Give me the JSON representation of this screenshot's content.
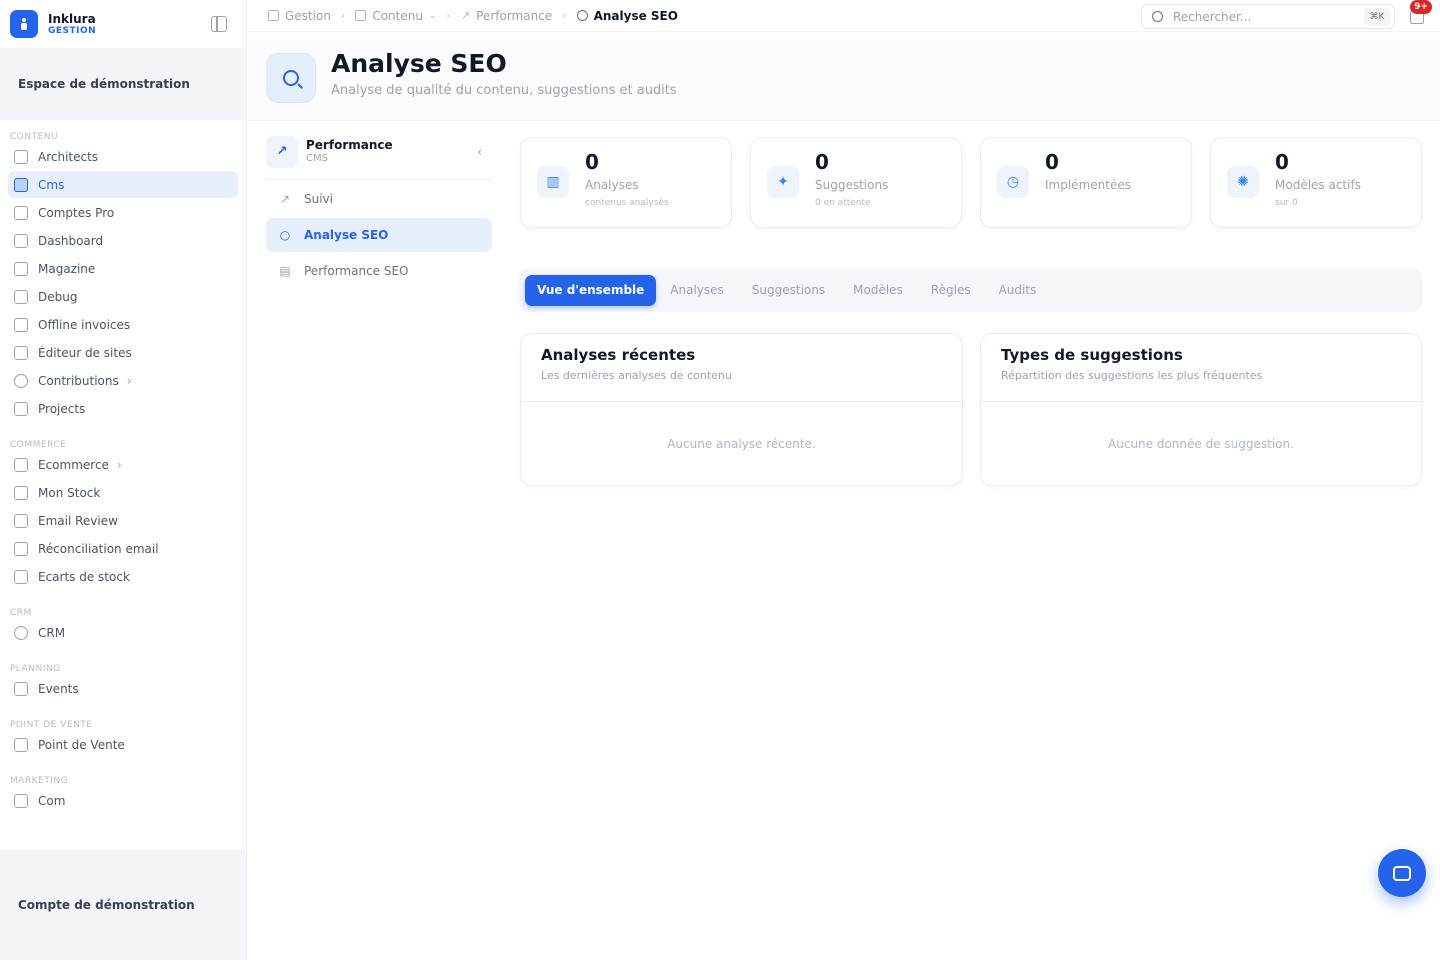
{
  "brand": {
    "name": "Inklura",
    "sub": "GESTION"
  },
  "sidebar": {
    "workspace": "Espace de démonstration",
    "account": "Compte de démonstration",
    "sections": [
      {
        "title": "CONTENU",
        "items": [
          {
            "label": "Architects",
            "icon": "building-icon",
            "active": false
          },
          {
            "label": "Cms",
            "icon": "document-icon",
            "active": true
          },
          {
            "label": "Comptes Pro",
            "icon": "document-icon",
            "active": false
          },
          {
            "label": "Dashboard",
            "icon": "grid-icon",
            "active": false
          },
          {
            "label": "Magazine",
            "icon": "newspaper-icon",
            "active": false
          },
          {
            "label": "Debug",
            "icon": "bug-icon",
            "active": false
          },
          {
            "label": "Offline invoices",
            "icon": "invoice-icon",
            "active": false
          },
          {
            "label": "Éditeur de sites",
            "icon": "terminal-icon",
            "active": false
          },
          {
            "label": "Contributions",
            "icon": "inbox-icon",
            "active": false,
            "chevron": true
          },
          {
            "label": "Projects",
            "icon": "folder-icon",
            "active": false
          }
        ]
      },
      {
        "title": "COMMERCE",
        "items": [
          {
            "label": "Ecommerce",
            "icon": "cart-icon",
            "active": false,
            "chevron": true
          },
          {
            "label": "Mon Stock",
            "icon": "cart-icon",
            "active": false
          },
          {
            "label": "Email Review",
            "icon": "cart-icon",
            "active": false
          },
          {
            "label": "Réconciliation email",
            "icon": "cart-icon",
            "active": false
          },
          {
            "label": "Ecarts de stock",
            "icon": "cart-icon",
            "active": false
          }
        ]
      },
      {
        "title": "CRM",
        "items": [
          {
            "label": "CRM",
            "icon": "users-icon",
            "active": false
          }
        ]
      },
      {
        "title": "PLANNING",
        "items": [
          {
            "label": "Events",
            "icon": "calendar-icon",
            "active": false
          }
        ]
      },
      {
        "title": "POINT DE VENTE",
        "items": [
          {
            "label": "Point de Vente",
            "icon": "store-icon",
            "active": false
          }
        ]
      },
      {
        "title": "MARKETING",
        "items": [
          {
            "label": "Com",
            "icon": "megaphone-icon",
            "active": false
          }
        ]
      }
    ]
  },
  "breadcrumb": [
    "Gestion",
    "Contenu",
    "Performance",
    "Analyse SEO"
  ],
  "search": {
    "placeholder": "Rechercher...",
    "shortcut": "⌘K"
  },
  "notifications": {
    "count": "9+"
  },
  "header": {
    "title": "Analyse SEO",
    "subtitle": "Analyse de qualité du contenu, suggestions et audits"
  },
  "subnav": {
    "title": "Performance",
    "subtitle": "CMS",
    "items": [
      {
        "label": "Suivi",
        "active": false
      },
      {
        "label": "Analyse SEO",
        "active": true
      },
      {
        "label": "Performance SEO",
        "active": false
      }
    ]
  },
  "stats": [
    {
      "value": "0",
      "label": "Analyses",
      "note": "contenus analysés"
    },
    {
      "value": "0",
      "label": "Suggestions",
      "note": "0 en attente"
    },
    {
      "value": "0",
      "label": "Implémentées",
      "note": ""
    },
    {
      "value": "0",
      "label": "Modèles actifs",
      "note": "sur 0"
    }
  ],
  "tabs": [
    "Vue d'ensemble",
    "Analyses",
    "Suggestions",
    "Modèles",
    "Règles",
    "Audits"
  ],
  "panels": {
    "recent": {
      "title": "Analyses récentes",
      "subtitle": "Les dernières analyses de contenu",
      "empty": "Aucune analyse récente."
    },
    "types": {
      "title": "Types de suggestions",
      "subtitle": "Répartition des suggestions les plus fréquentes",
      "empty": "Aucune donnée de suggestion."
    }
  },
  "colors": {
    "accent": "#2563eb",
    "badge": "#dc2626"
  }
}
